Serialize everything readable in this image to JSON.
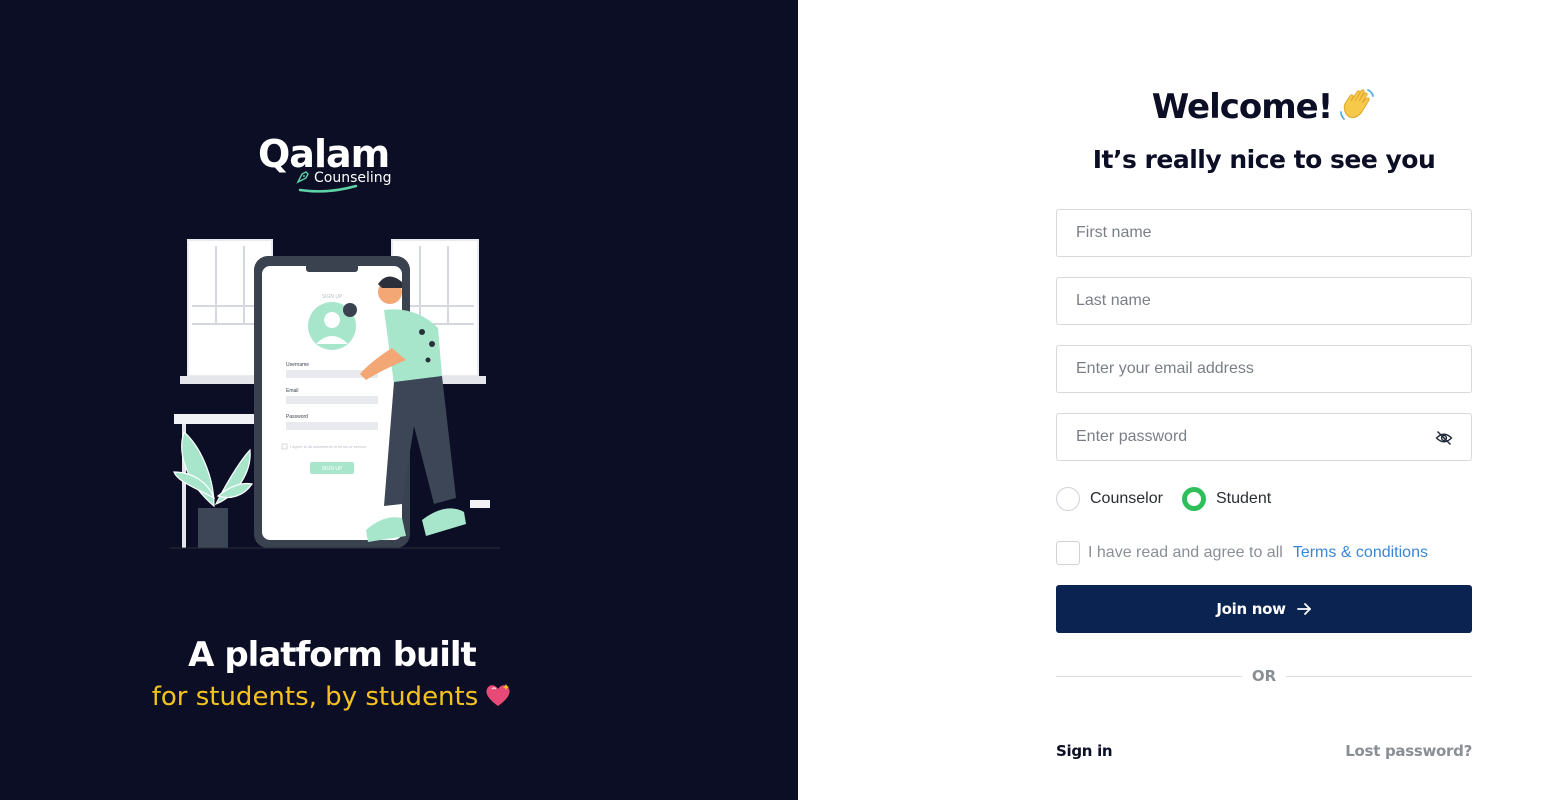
{
  "brand": {
    "name_main": "Qalam",
    "name_sub": "Counseling",
    "accent_color": "#5fd3a8"
  },
  "hero": {
    "tagline_line1": "A platform built",
    "tagline_line2": "for students, by students",
    "illustration_screen": {
      "title": "SIGN UP",
      "username_label": "Username",
      "email_label": "Email",
      "password_label": "Password",
      "terms_text": "I agree to all statements in terms of service",
      "button_label": "SIGN UP"
    }
  },
  "form": {
    "title": "Welcome!",
    "subtitle": "It’s really nice to see you",
    "first_name_placeholder": "First name",
    "last_name_placeholder": "Last name",
    "email_placeholder": "Enter your email address",
    "password_placeholder": "Enter password",
    "roles": [
      {
        "label": "Counselor",
        "selected": false
      },
      {
        "label": "Student",
        "selected": true
      }
    ],
    "agree_text": "I have read and agree to all",
    "terms_link": "Terms & conditions",
    "submit_label": "Join now",
    "divider_text": "OR",
    "sign_in_label": "Sign in",
    "lost_password_label": "Lost password?"
  },
  "colors": {
    "left_bg": "#0b0e24",
    "primary_button": "#0a2350",
    "radio_selected": "#2fbf5a",
    "link": "#3a86d8",
    "tagline_yellow": "#f4c21f"
  },
  "icons": {
    "wave": "waving-hand-icon",
    "heart": "sparkling-heart-icon",
    "password_toggle": "eye-off-icon",
    "submit": "arrow-right-icon"
  }
}
